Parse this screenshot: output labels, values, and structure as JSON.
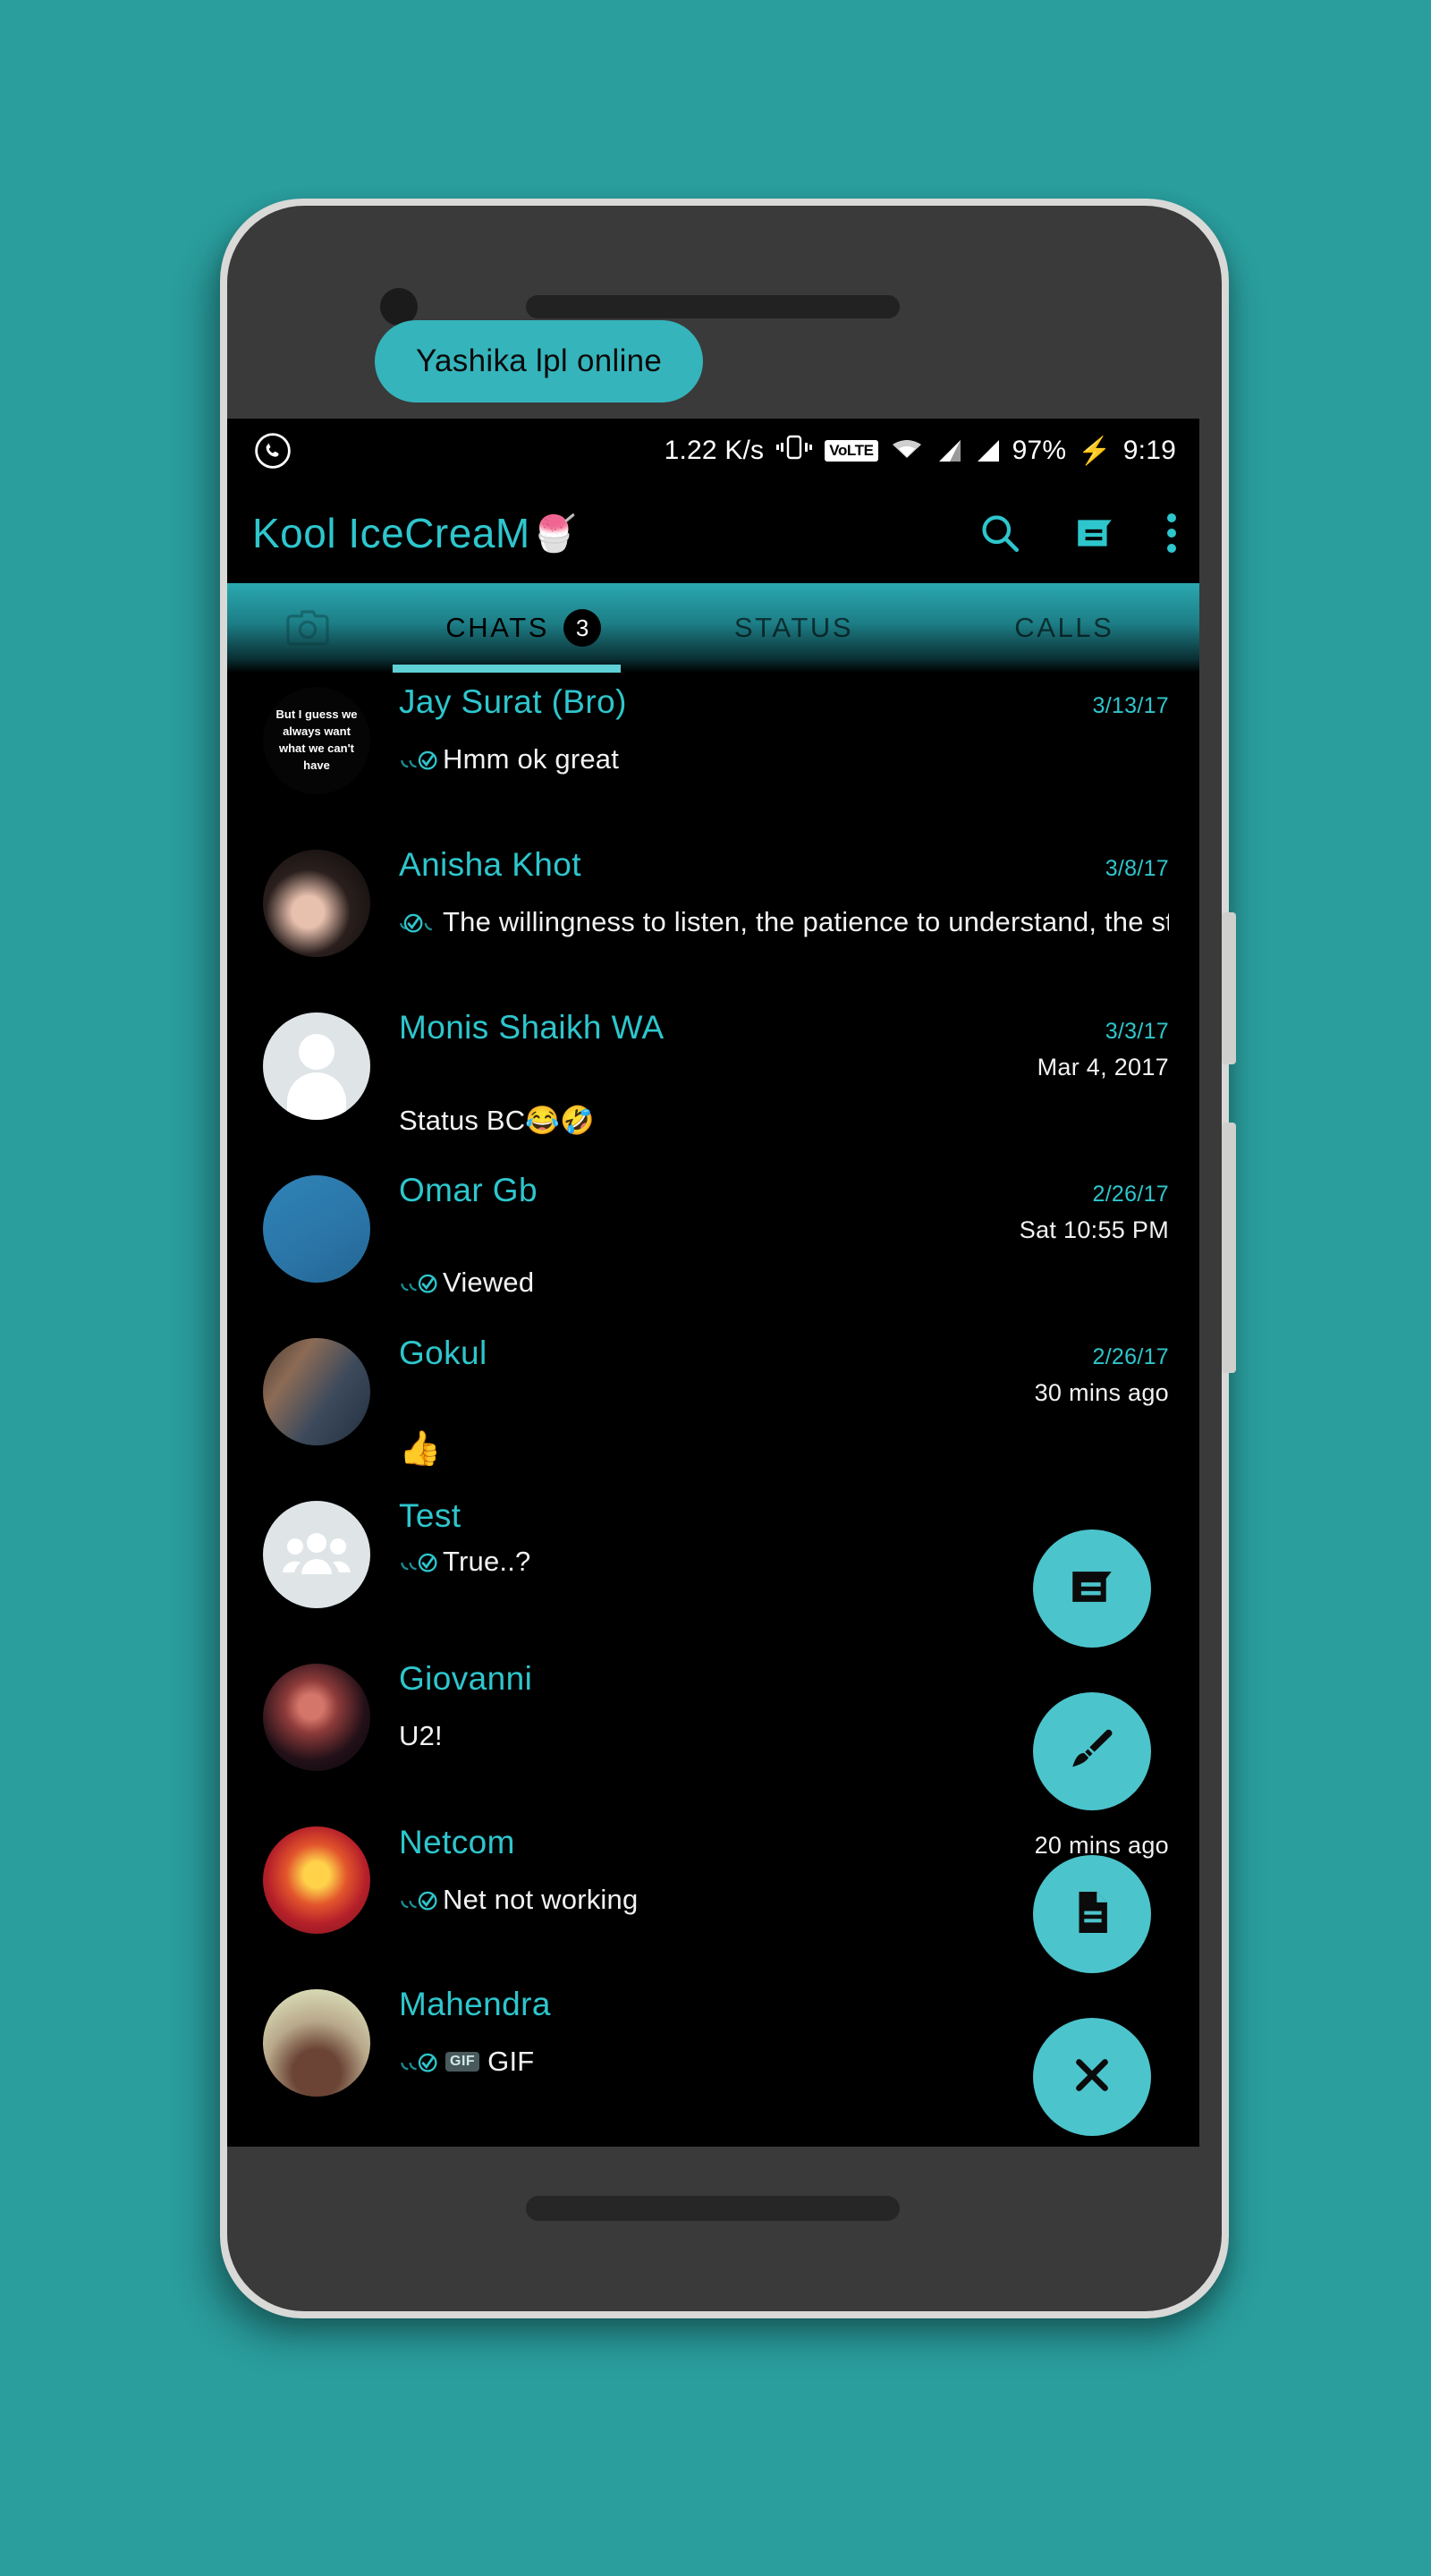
{
  "theme": {
    "background": "#2a9d9d",
    "accent": "#2ec6cd",
    "fab": "#4cc4cc",
    "tab_gradient_top": "#2aa8b0",
    "screen_bg": "#000000"
  },
  "status_bar": {
    "app_icon": "whatsapp-icon",
    "network_speed": "1.22 K/s",
    "vibrate_icon": "vibrate-icon",
    "volte_label": "VoLTE",
    "wifi_icon": "wifi-icon",
    "signal_1_icon": "signal-bars-icon",
    "signal_2_icon": "signal-bars-icon",
    "battery_percent": "97%",
    "charging_icon": "charging-bolt-icon",
    "time": "9:19"
  },
  "app_bar": {
    "title": "Kool IceCreaM",
    "title_emoji": "🍧",
    "tooltip": "Yashika lpl online",
    "actions": [
      {
        "name": "search-icon",
        "label": "Search"
      },
      {
        "name": "message-icon",
        "label": "New message"
      },
      {
        "name": "overflow-menu-icon",
        "label": "More options"
      }
    ]
  },
  "tabs": {
    "camera_icon": "camera-icon",
    "items": [
      {
        "label": "CHATS",
        "badge": "3",
        "active": true
      },
      {
        "label": "STATUS",
        "badge": "",
        "active": false
      },
      {
        "label": "CALLS",
        "badge": "",
        "active": false
      }
    ]
  },
  "chats": [
    {
      "name": "Jay Surat (Bro)",
      "date": "3/13/17",
      "sub_meta": "",
      "message": "Hmm ok great",
      "ticks": "double-check",
      "avatar_type": "quote",
      "avatar_text": "But I guess we always want what we can't have",
      "gif_badge": ""
    },
    {
      "name": "Anisha Khot",
      "date": "3/8/17",
      "sub_meta": "",
      "message": "The willingness to listen, the patience to understand, the stren...",
      "ticks": "double-check",
      "avatar_type": "photo",
      "avatar_text": "",
      "gif_badge": ""
    },
    {
      "name": "Monis Shaikh WA",
      "date": "3/3/17",
      "sub_meta": "Mar 4, 2017",
      "message": "Status BC😂🤣",
      "ticks": "none",
      "avatar_type": "default",
      "avatar_text": "",
      "gif_badge": ""
    },
    {
      "name": "Omar Gb",
      "date": "2/26/17",
      "sub_meta": "Sat 10:55 PM",
      "message": "Viewed",
      "ticks": "double-check",
      "avatar_type": "solid",
      "avatar_text": "",
      "gif_badge": ""
    },
    {
      "name": "Gokul",
      "date": "2/26/17",
      "sub_meta": "30 mins  ago",
      "message": "👍",
      "ticks": "none",
      "avatar_type": "photo",
      "avatar_text": "",
      "gif_badge": ""
    },
    {
      "name": "Test",
      "date": "",
      "sub_meta": "",
      "message": "True..?",
      "ticks": "double-check",
      "avatar_type": "group",
      "avatar_text": "",
      "gif_badge": ""
    },
    {
      "name": "Giovanni",
      "date": "",
      "sub_meta": "",
      "message": "U2!",
      "ticks": "none",
      "avatar_type": "photo",
      "avatar_text": "",
      "gif_badge": ""
    },
    {
      "name": "Netcom",
      "date": "",
      "sub_meta": "20 mins  ago",
      "message": "Net not working",
      "ticks": "double-check",
      "avatar_type": "photo",
      "avatar_text": "",
      "gif_badge": ""
    },
    {
      "name": "Mahendra",
      "date": "",
      "sub_meta": "",
      "message": "GIF",
      "ticks": "double-check",
      "avatar_type": "photo",
      "avatar_text": "",
      "gif_badge": "GIF"
    }
  ],
  "fabs": [
    {
      "name": "new-chat-fab",
      "icon": "message-icon"
    },
    {
      "name": "paint-fab",
      "icon": "paintbrush-icon"
    },
    {
      "name": "document-fab",
      "icon": "document-icon"
    },
    {
      "name": "close-fab",
      "icon": "close-icon"
    }
  ]
}
